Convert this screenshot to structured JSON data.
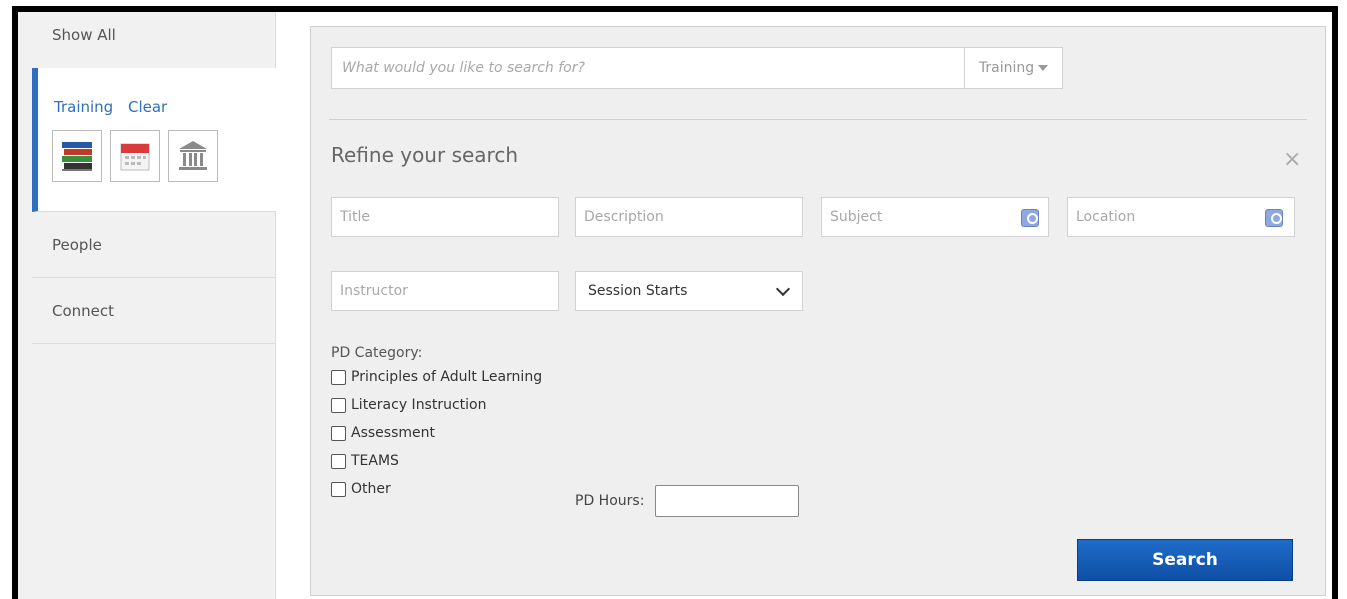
{
  "sidebar": {
    "show_all": "Show All",
    "active_section": {
      "label": "Training",
      "clear": "Clear",
      "tiles": [
        {
          "icon": "books-icon"
        },
        {
          "icon": "calendar-icon"
        },
        {
          "icon": "building-icon"
        }
      ]
    },
    "items": [
      {
        "label": "People"
      },
      {
        "label": "Connect"
      }
    ]
  },
  "search": {
    "placeholder": "What would you like to search for?",
    "scope": "Training"
  },
  "refine": {
    "title": "Refine your search",
    "close": "×",
    "fields": {
      "title_placeholder": "Title",
      "description_placeholder": "Description",
      "subject_placeholder": "Subject",
      "location_placeholder": "Location",
      "instructor_placeholder": "Instructor"
    },
    "session_select": "Session Starts",
    "category_label": "PD Category:",
    "categories": [
      "Principles of Adult Learning",
      "Literacy Instruction",
      "Assessment",
      "TEAMS",
      "Other"
    ],
    "hours_label": "PD Hours:",
    "search_button": "Search"
  },
  "colors": {
    "accent": "#2d6fc0",
    "button": "#1560bd"
  }
}
